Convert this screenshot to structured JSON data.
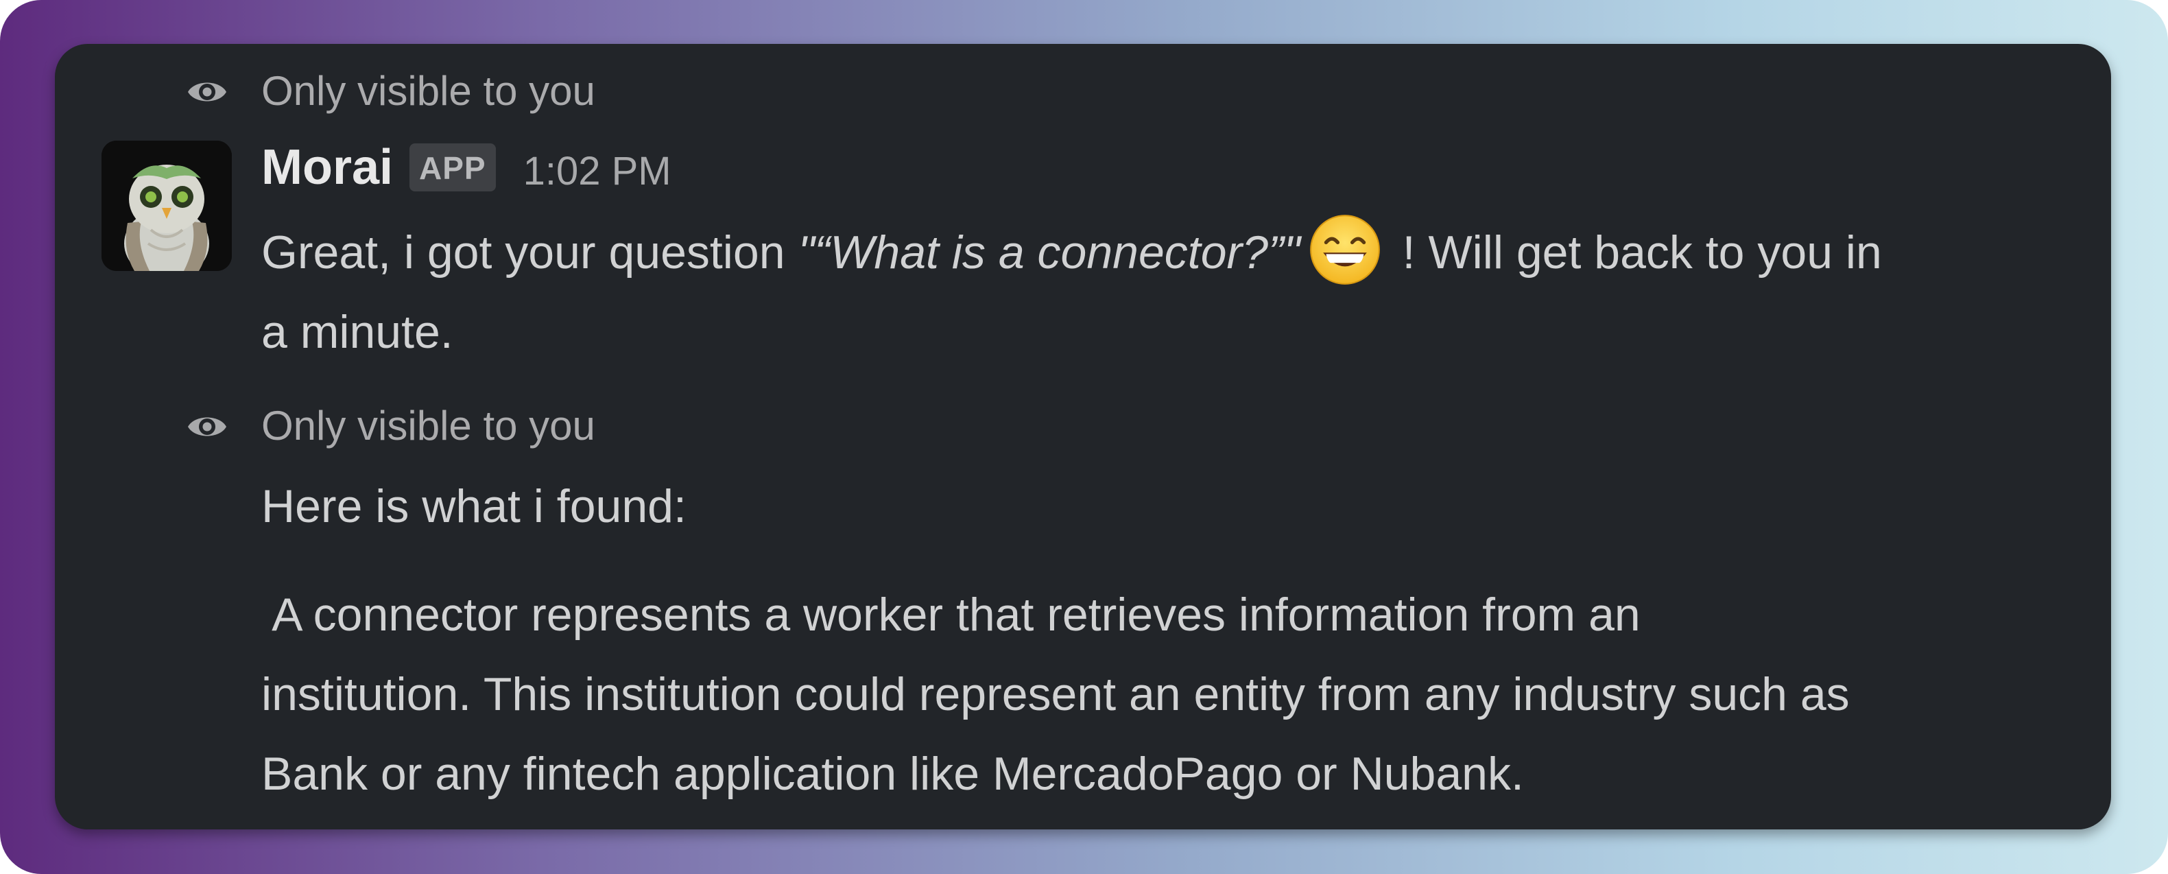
{
  "message1": {
    "visibility_label": "Only visible to you",
    "sender": "Morai",
    "badge": "APP",
    "timestamp": "1:02 PM",
    "text_before": "Great, i got your question ",
    "question_quoted": "\"“What is a connector?”\"",
    "emoji": "grinning-face-smiling-eyes",
    "text_after_line1": " ! Will get back to you in",
    "text_line2": "a minute."
  },
  "message2": {
    "visibility_label": "Only visible to you",
    "intro": "Here is what i found:",
    "answer_line1": " A connector represents a worker that retrieves information from an",
    "answer_line2": "institution. This institution could represent an entity from any industry such as",
    "answer_line3": "Bank or any fintech application like MercadoPago or Nubank."
  },
  "colors": {
    "panel_bg": "#222529",
    "text_primary": "#d1d2d3",
    "text_muted": "#ababad",
    "badge_bg": "#3e4044"
  },
  "icons": {
    "visibility": "eye-icon",
    "avatar": "owl-avatar"
  }
}
